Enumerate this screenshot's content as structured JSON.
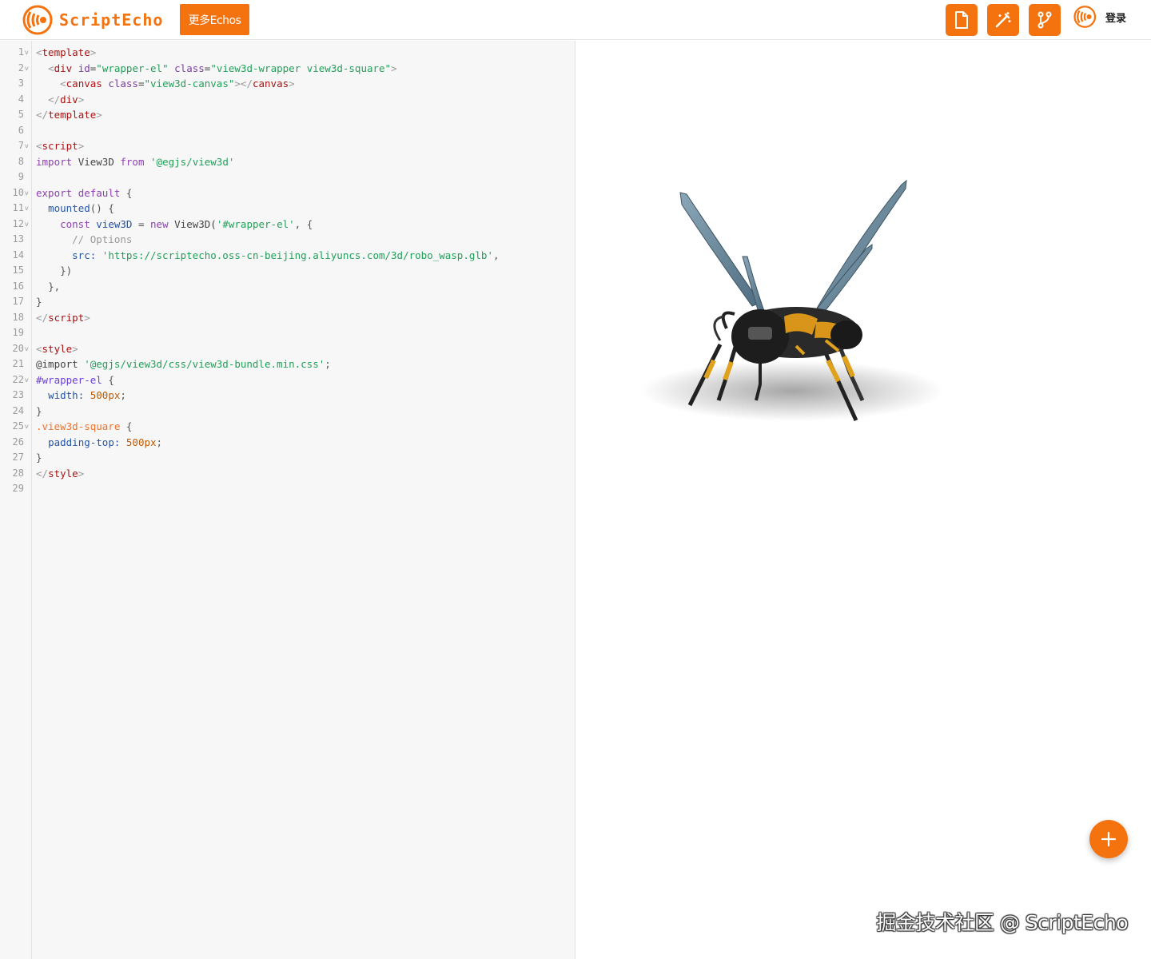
{
  "header": {
    "brand": "ScriptEcho",
    "more_echos_label": "更多Echos",
    "login_label": "登录",
    "accent_color": "#f5730f",
    "tools": [
      "new-file-icon",
      "magic-wand-icon",
      "git-branch-icon"
    ]
  },
  "editor": {
    "line_numbers": [
      "1",
      "2",
      "3",
      "4",
      "5",
      "6",
      "7",
      "8",
      "9",
      "10",
      "11",
      "12",
      "13",
      "14",
      "15",
      "16",
      "17",
      "18",
      "19",
      "20",
      "21",
      "22",
      "23",
      "24",
      "25",
      "26",
      "27",
      "28",
      "29"
    ],
    "code": {
      "l1_tag": "template",
      "l2_tag": "div",
      "l2_attr1": "id",
      "l2_val1": "\"wrapper-el\"",
      "l2_attr2": "class",
      "l2_val2": "\"view3d-wrapper view3d-square\"",
      "l3_tag": "canvas",
      "l3_attr": "class",
      "l3_val": "\"view3d-canvas\"",
      "l3_close": "canvas",
      "l4_tag": "div",
      "l5_tag": "template",
      "l7_tag": "script",
      "l8_import": "import",
      "l8_name": "View3D",
      "l8_from": "from",
      "l8_path": "'@egjs/view3d'",
      "l10_export": "export",
      "l10_default": "default",
      "l10_brace": "{",
      "l11_mounted": "mounted",
      "l11_rest": "() {",
      "l12_const": "const",
      "l12_var": "view3D",
      "l12_eq": "=",
      "l12_new": "new",
      "l12_cls": "View3D(",
      "l12_arg": "'#wrapper-el'",
      "l12_rest": ", {",
      "l13_comment": "// Options",
      "l14_key": "src:",
      "l14_val": "'https://scriptecho.oss-cn-beijing.aliyuncs.com/3d/robo_wasp.glb'",
      "l14_rest": ",",
      "l15": "})",
      "l16": "},",
      "l17": "}",
      "l18_tag": "script",
      "l20_tag": "style",
      "l21_at": "@import",
      "l21_val": "'@egjs/view3d/css/view3d-bundle.min.css'",
      "l21_rest": ";",
      "l22_sel": "#wrapper-el",
      "l22_rest": " {",
      "l23_prop": "width:",
      "l23_val": "500px",
      "l23_rest": ";",
      "l24": "}",
      "l25_sel": ".view3d-square",
      "l25_rest": " {",
      "l26_prop": "padding-top:",
      "l26_val": "500px",
      "l26_rest": ";",
      "l27": "}",
      "l28_tag": "style"
    },
    "fold_lines": [
      "1",
      "2",
      "7",
      "10",
      "11",
      "12",
      "20",
      "22",
      "25"
    ]
  },
  "preview": {
    "model_name": "robo_wasp",
    "watermark": "掘金技术社区 @ ScriptEcho"
  }
}
